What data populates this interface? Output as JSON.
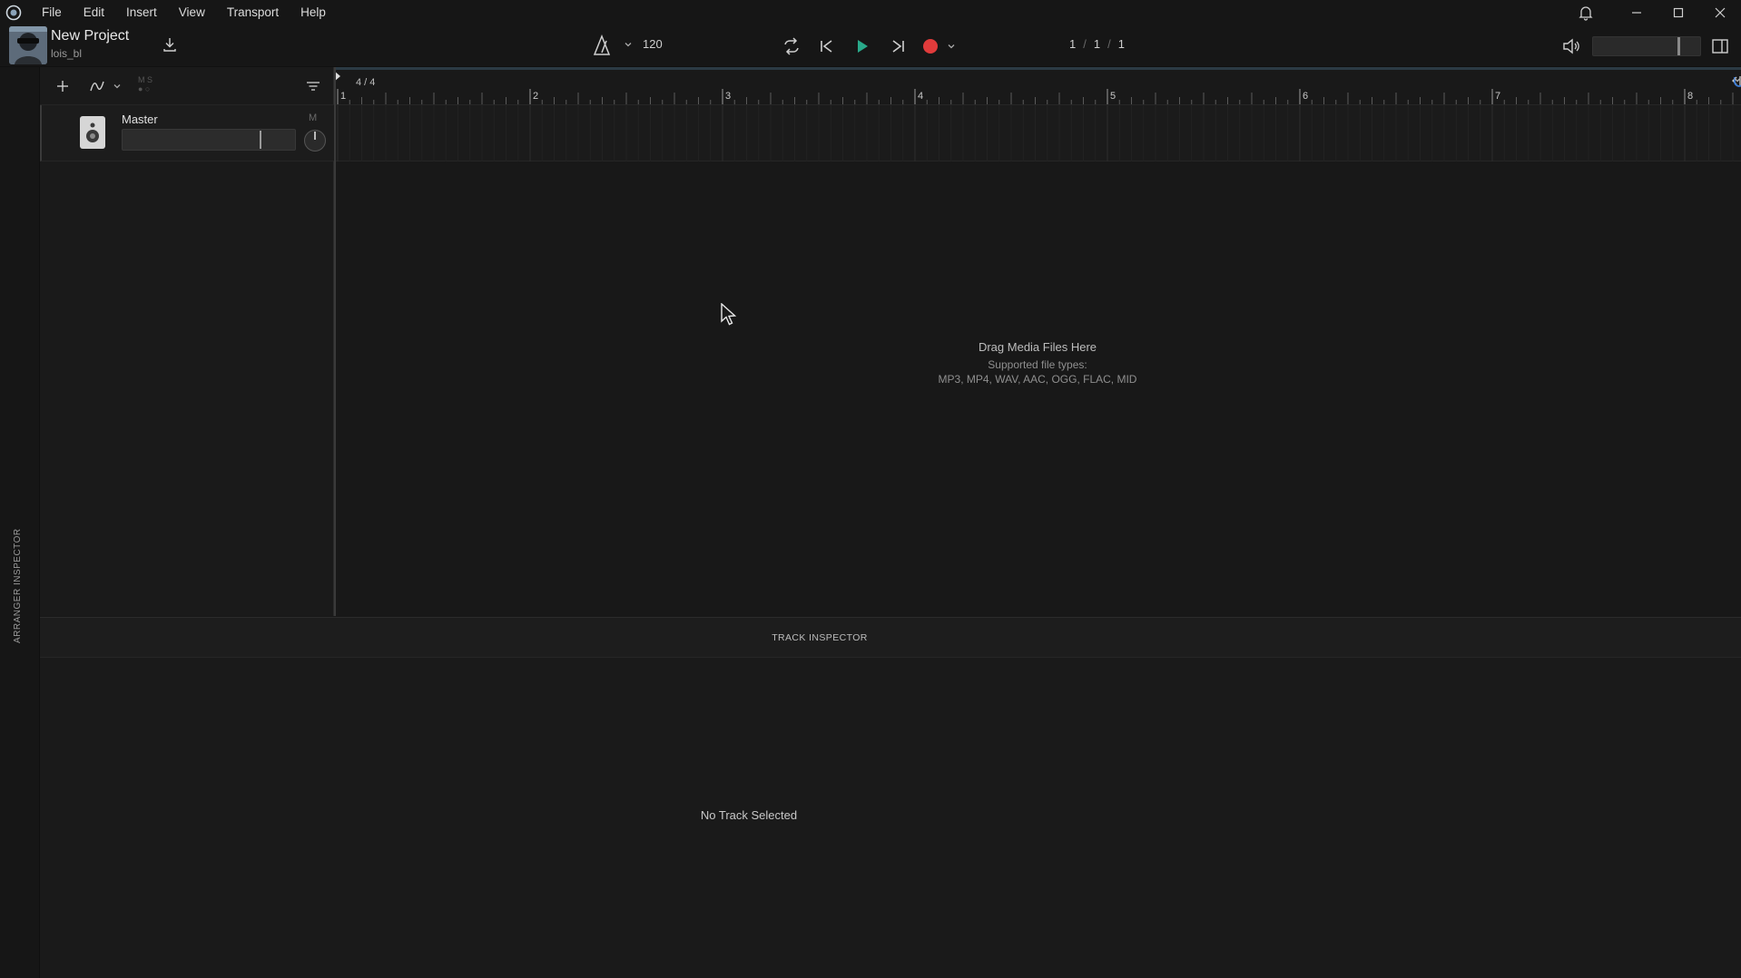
{
  "menubar": {
    "items": [
      "File",
      "Edit",
      "Insert",
      "View",
      "Transport",
      "Help"
    ]
  },
  "project": {
    "title": "New Project",
    "user": "lois_bl"
  },
  "toolbar": {
    "tempo": "120",
    "position": {
      "bar": "1",
      "beat": "1",
      "tick": "1",
      "separator": "/"
    }
  },
  "left_strip": {
    "label": "ARRANGER INSPECTOR"
  },
  "tracks": [
    {
      "name": "Master",
      "mute_label": "M"
    }
  ],
  "track_toolbar": {
    "ms_top": "M S",
    "ms_bottom": "● ○"
  },
  "ruler": {
    "time_signature": "4 / 4",
    "bars": [
      "1",
      "2",
      "3",
      "4",
      "5",
      "6",
      "7",
      "8"
    ]
  },
  "arranger": {
    "drop_title": "Drag Media Files Here",
    "drop_subtitle": "Supported file types:",
    "drop_types": "MP3, MP4, WAV, AAC, OGG, FLAC, MID"
  },
  "inspector": {
    "title": "TRACK INSPECTOR",
    "empty_text": "No Track Selected"
  },
  "colors": {
    "play": "#29a98a",
    "record": "#e03b3b",
    "background": "#181818",
    "panel": "#1a1a1a"
  }
}
